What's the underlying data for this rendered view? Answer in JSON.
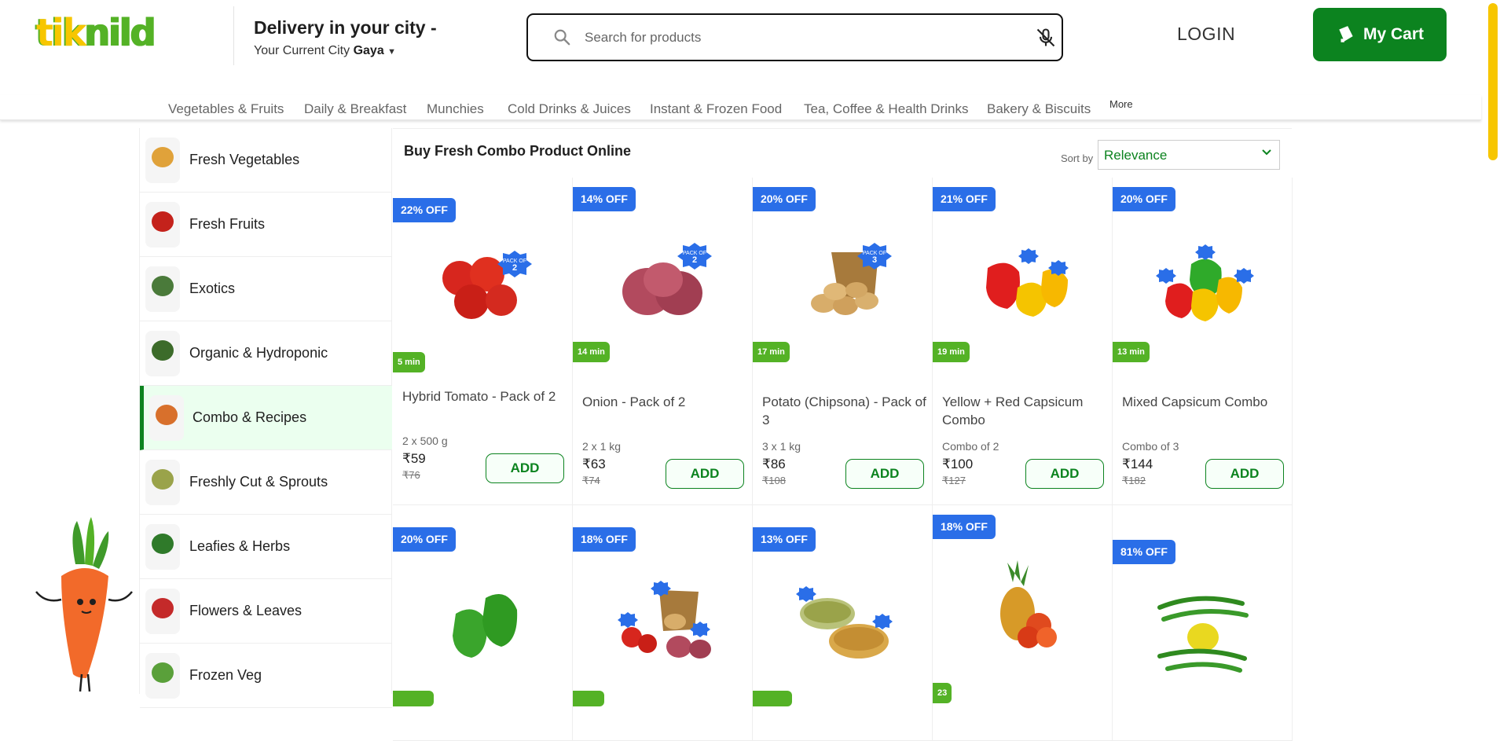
{
  "header": {
    "logo_text": "tiknild",
    "delivery_title": "Delivery in your city -",
    "city_prefix": "Your Current City",
    "city_name": "Gaya",
    "search_placeholder": "Search for products",
    "login_label": "LOGIN",
    "cart_label": "My Cart"
  },
  "categories": [
    "Vegetables & Fruits",
    "Daily & Breakfast",
    "Munchies",
    "Cold Drinks & Juices",
    "Instant & Frozen Food",
    "Tea, Coffee & Health Drinks",
    "Bakery & Biscuits"
  ],
  "more_label": "More",
  "sidebar": {
    "items": [
      {
        "label": "Fresh Vegetables",
        "color": "#e0a23a",
        "active": false
      },
      {
        "label": "Fresh Fruits",
        "color": "#c4221b",
        "active": false
      },
      {
        "label": "Exotics",
        "color": "#4a7a3a",
        "active": false
      },
      {
        "label": "Organic & Hydroponic",
        "color": "#3c6b2a",
        "active": false
      },
      {
        "label": "Combo & Recipes",
        "color": "#d8702c",
        "active": true
      },
      {
        "label": "Freshly Cut & Sprouts",
        "color": "#9aa34a",
        "active": false
      },
      {
        "label": "Leafies & Herbs",
        "color": "#2f7a2a",
        "active": false
      },
      {
        "label": "Flowers & Leaves",
        "color": "#c42a2a",
        "active": false
      },
      {
        "label": "Frozen Veg",
        "color": "#5aa03a",
        "active": false
      }
    ]
  },
  "main": {
    "title": "Buy Fresh Combo Product Online",
    "sort_label": "Sort by",
    "sort_value": "Relevance"
  },
  "products": [
    {
      "off": "22% OFF",
      "eta": "5 min",
      "name": "Hybrid Tomato - Pack of 2",
      "qty": "2 x 500 g",
      "price": "₹59",
      "mrp": "₹76",
      "add": "ADD",
      "icon": "tomato-icon"
    },
    {
      "off": "14% OFF",
      "eta": "14 min",
      "name": "Onion - Pack of 2",
      "qty": "2 x 1 kg",
      "price": "₹63",
      "mrp": "₹74",
      "add": "ADD",
      "icon": "onion-icon"
    },
    {
      "off": "20% OFF",
      "eta": "17 min",
      "name": "Potato (Chipsona) - Pack of 3",
      "qty": "3 x 1 kg",
      "price": "₹86",
      "mrp": "₹108",
      "add": "ADD",
      "icon": "potato-icon"
    },
    {
      "off": "21% OFF",
      "eta": "19 min",
      "name": "Yellow + Red Capsicum Combo",
      "qty": "Combo of 2",
      "price": "₹100",
      "mrp": "₹127",
      "add": "ADD",
      "icon": "capsicum-icon"
    },
    {
      "off": "20% OFF",
      "eta": "13 min",
      "name": "Mixed Capsicum Combo",
      "qty": "Combo of 3",
      "price": "₹144",
      "mrp": "₹182",
      "add": "ADD",
      "icon": "mixed-capsicum-icon"
    },
    {
      "off": "20% OFF",
      "eta": "",
      "icon": "green-capsicum-icon"
    },
    {
      "off": "18% OFF",
      "eta": "",
      "icon": "veg-combo-icon"
    },
    {
      "off": "13% OFF",
      "eta": "",
      "icon": "sprouts-icon"
    },
    {
      "off": "18% OFF",
      "eta": "23",
      "icon": "fruit-combo-icon"
    },
    {
      "off": "81% OFF",
      "eta": "",
      "icon": "chilli-lemon-icon"
    }
  ],
  "colors": {
    "brand_green": "#0c831f",
    "accent_yellow": "#f7c600",
    "offer_blue": "#2a6ee8",
    "eta_green": "#54b226"
  }
}
